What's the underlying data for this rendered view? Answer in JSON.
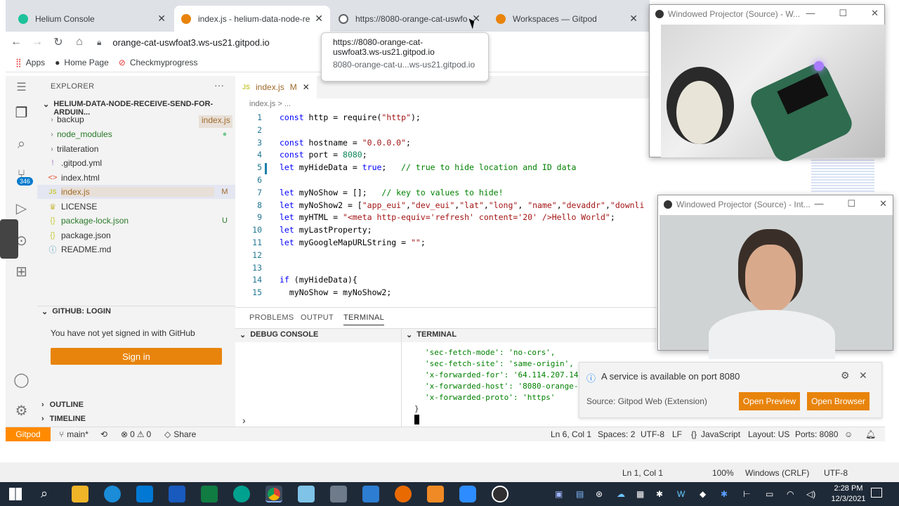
{
  "browser": {
    "tabs": [
      {
        "title": "Helium Console",
        "active": false,
        "color": "#1ec29a"
      },
      {
        "title": "index.js - helium-data-node-rece",
        "active": true,
        "color": "#e8840c"
      },
      {
        "title": "https://8080-orange-cat-uswfoa",
        "active": false,
        "color": "#5f6368"
      },
      {
        "title": "Workspaces — Gitpod",
        "active": false,
        "color": "#e8840c"
      }
    ],
    "url": "orange-cat-uswfoat3.ws-us21.gitpod.io",
    "bookmarks": [
      "Apps",
      "Home Page",
      "Checkmyprogress"
    ],
    "tooltip": {
      "line1": "https://8080-orange-cat-",
      "line2": "uswfoat3.ws-us21.gitpod.io",
      "domain": "8080-orange-cat-u...ws-us21.gitpod.io"
    }
  },
  "sidebar": {
    "explorer_title": "EXPLORER",
    "folder": "HELIUM-DATA-NODE-RECEIVE-SEND-FOR-ARDUIN...",
    "open_editor_hint": "index.js",
    "items": [
      {
        "name": "backup",
        "type": "folder",
        "status": ""
      },
      {
        "name": "node_modules",
        "type": "folder",
        "status": "●"
      },
      {
        "name": "trilateration",
        "type": "folder",
        "status": ""
      },
      {
        "name": ".gitpod.yml",
        "type": "yml",
        "status": ""
      },
      {
        "name": "index.html",
        "type": "html",
        "status": ""
      },
      {
        "name": "index.js",
        "type": "js",
        "status": "M"
      },
      {
        "name": "LICENSE",
        "type": "license",
        "status": ""
      },
      {
        "name": "package-lock.json",
        "type": "json",
        "status": "U"
      },
      {
        "name": "package.json",
        "type": "json",
        "status": ""
      },
      {
        "name": "README.md",
        "type": "md",
        "status": ""
      }
    ],
    "github_title": "GITHUB: LOGIN",
    "github_text": "You have not yet signed in with GitHub",
    "signin_label": "Sign in",
    "outline_title": "OUTLINE",
    "timeline_title": "TIMELINE",
    "badge_count": "346"
  },
  "editor": {
    "tab_label": "index.js",
    "tab_status": "M",
    "breadcrumb": "index.js > ...",
    "lines": [
      {
        "n": "1",
        "t": "const http = require(\"http\");"
      },
      {
        "n": "2",
        "t": ""
      },
      {
        "n": "3",
        "t": "const hostname = \"0.0.0.0\";"
      },
      {
        "n": "4",
        "t": "const port = 8080;"
      },
      {
        "n": "5",
        "t": "let myHideData = true;   // true to hide location and ID data"
      },
      {
        "n": "6",
        "t": ""
      },
      {
        "n": "7",
        "t": "let myNoShow = [];   // key to values to hide!"
      },
      {
        "n": "8",
        "t": "let myNoShow2 = [\"app_eui\",\"dev_eui\",\"lat\",\"long\", \"name\",\"devaddr\",\"downli"
      },
      {
        "n": "9",
        "t": "let myHTML = \"<meta http-equiv='refresh' content='20' />Hello World\";"
      },
      {
        "n": "10",
        "t": "let myLastProperty;"
      },
      {
        "n": "11",
        "t": "let myGoogleMapURLString = \"\";"
      },
      {
        "n": "12",
        "t": ""
      },
      {
        "n": "13",
        "t": ""
      },
      {
        "n": "14",
        "t": "if (myHideData){"
      },
      {
        "n": "15",
        "t": "  myNoShow = myNoShow2;"
      }
    ]
  },
  "panel": {
    "tabs": [
      "PROBLEMS",
      "OUTPUT",
      "TERMINAL"
    ],
    "debug_console": "DEBUG CONSOLE",
    "terminal": "TERMINAL",
    "terminal_lines": [
      "'sec-fetch-mode': 'no-cors',",
      "'sec-fetch-site': 'same-origin',",
      "'x-forwarded-for': '64.114.207.149",
      "'x-forwarded-host': '8080-orange-c",
      "'x-forwarded-proto': 'https'",
      "}"
    ]
  },
  "notification": {
    "message": "A service is available on port 8080",
    "source": "Source: Gitpod Web (Extension)",
    "open_preview": "Open Preview",
    "open_browser": "Open Browser"
  },
  "statusbar": {
    "gitpod": "Gitpod",
    "branch": "main*",
    "errors": "0",
    "warnings": "0",
    "share": "Share",
    "position": "Ln 6, Col 1",
    "spaces": "Spaces: 2",
    "encoding": "UTF-8",
    "eol": "LF",
    "language": "JavaScript",
    "layout": "Layout: US",
    "ports": "Ports: 8080"
  },
  "windows_status": {
    "position": "Ln 1, Col 1",
    "zoom": "100%",
    "eol": "Windows (CRLF)",
    "encoding": "UTF-8"
  },
  "projectors": {
    "top_title": "Windowed Projector (Source) - W...",
    "bottom_title": "Windowed Projector (Source) - Int..."
  },
  "taskbar": {
    "time": "2:28 PM",
    "date": "12/3/2021"
  },
  "colors": {
    "accent": "#e8840c",
    "gitpod": "#ff8a00",
    "terminal_green": "#008000"
  }
}
